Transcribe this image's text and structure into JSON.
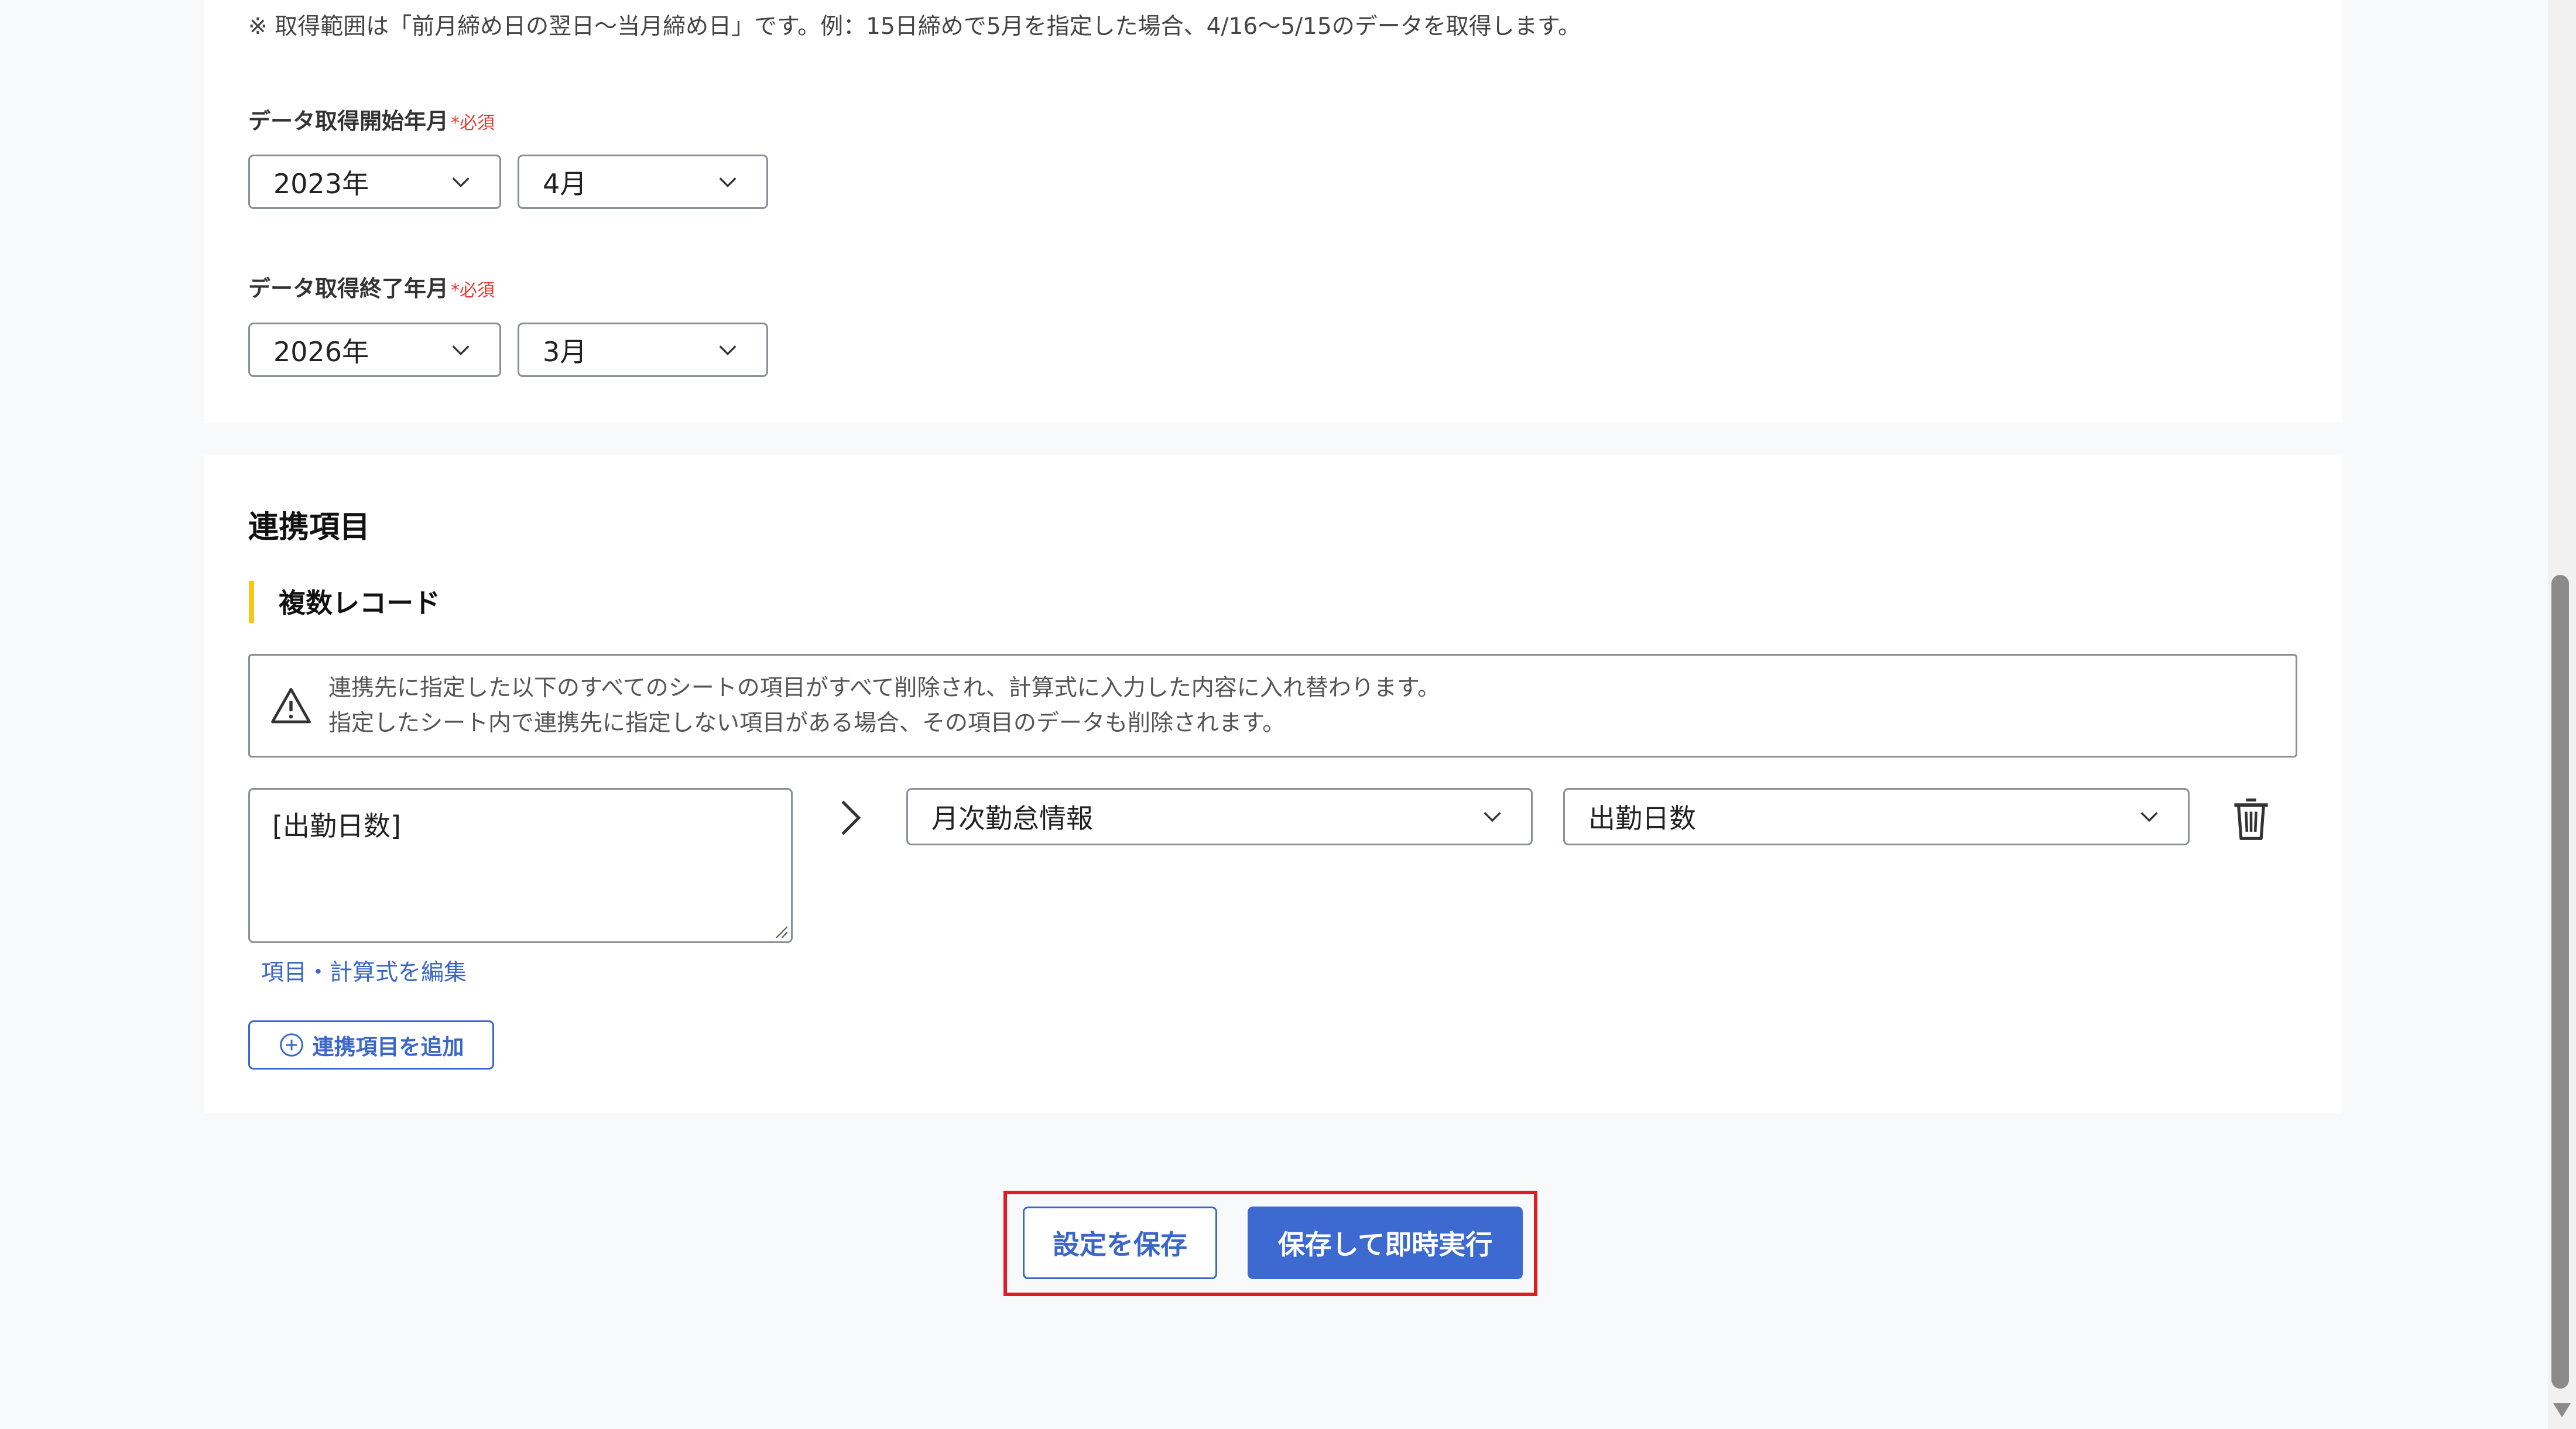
{
  "range_note": "※ 取得範囲は「前月締め日の翌日〜当月締め日」です。例：15日締めで5月を指定した場合、4/16〜5/15のデータを取得します。",
  "start": {
    "label": "データ取得開始年月",
    "required_mark": "*",
    "required_text": "必須",
    "year": "2023年",
    "month": "4月"
  },
  "end": {
    "label": "データ取得終了年月",
    "required_mark": "*",
    "required_text": "必須",
    "year": "2026年",
    "month": "3月"
  },
  "mapping": {
    "section_title": "連携項目",
    "sub_title": "複数レコード",
    "warning": {
      "line1": "連携先に指定した以下のすべてのシートの項目がすべて削除され、計算式に入力した内容に入れ替わります。",
      "line2": "指定したシート内で連携先に指定しない項目がある場合、その項目のデータも削除されます。"
    },
    "formula_value": "[出勤日数]",
    "edit_link": "項目・計算式を編集",
    "target_sheet": "月次勤怠情報",
    "target_field": "出勤日数",
    "add_button": "連携項目を追加"
  },
  "actions": {
    "save_label": "設定を保存",
    "save_run_label": "保存して即時実行"
  },
  "colors": {
    "accent": "#3d6ad0",
    "required": "#e53935",
    "highlight": "#e01b24",
    "sub_bar": "#f5c518"
  },
  "icons": [
    "chevron-down-icon",
    "warning-icon",
    "chevron-right-icon",
    "trash-icon",
    "plus-circle-icon"
  ]
}
